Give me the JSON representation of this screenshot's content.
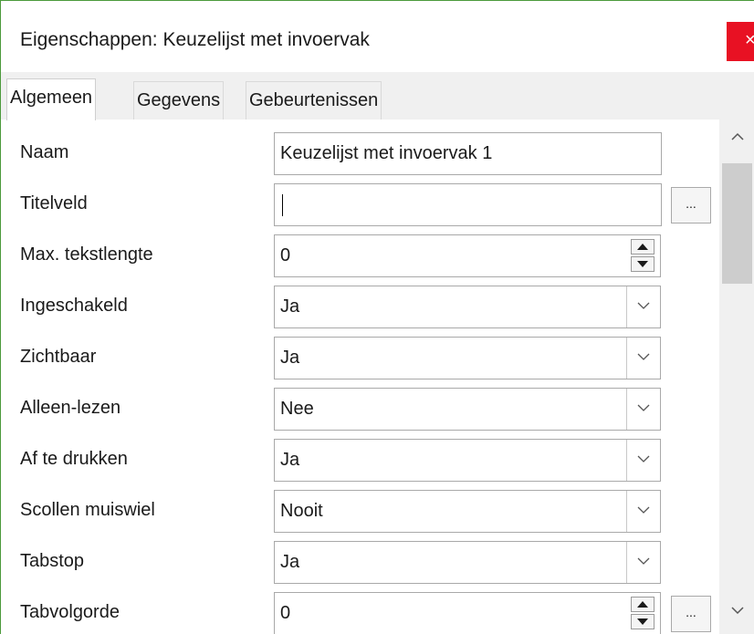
{
  "window": {
    "title": "Eigenschappen: Keuzelijst met invoervak",
    "close_label": "×"
  },
  "tabs": [
    {
      "label": "Algemeen",
      "active": true
    },
    {
      "label": "Gegevens",
      "active": false
    },
    {
      "label": "Gebeurtenissen",
      "active": false
    }
  ],
  "properties": {
    "naam": {
      "label": "Naam",
      "value": "Keuzelijst met invoervak 1"
    },
    "titelveld": {
      "label": "Titelveld",
      "value": ""
    },
    "max_tekstlengte": {
      "label": "Max. tekstlengte",
      "value": "0"
    },
    "ingeschakeld": {
      "label": "Ingeschakeld",
      "value": "Ja"
    },
    "zichtbaar": {
      "label": "Zichtbaar",
      "value": "Ja"
    },
    "alleen_lezen": {
      "label": "Alleen-lezen",
      "value": "Nee"
    },
    "af_te_drukken": {
      "label": "Af te drukken",
      "value": "Ja"
    },
    "scrollen_muiswiel": {
      "label": "Scollen muiswiel",
      "value": "Nooit"
    },
    "tabstop": {
      "label": "Tabstop",
      "value": "Ja"
    },
    "tabvolgorde": {
      "label": "Tabvolgorde",
      "value": "0"
    }
  },
  "buttons": {
    "ellipsis_label": "..."
  },
  "icons": {
    "close": "close-icon",
    "combo": "chevron-down-icon",
    "spin_up": "triangle-up-icon",
    "spin_down": "triangle-down-icon",
    "scroll_up": "chevron-up-icon",
    "scroll_down": "chevron-down-icon"
  },
  "colors": {
    "close_button": "#e81123",
    "window_border": "#4c9a3c"
  }
}
